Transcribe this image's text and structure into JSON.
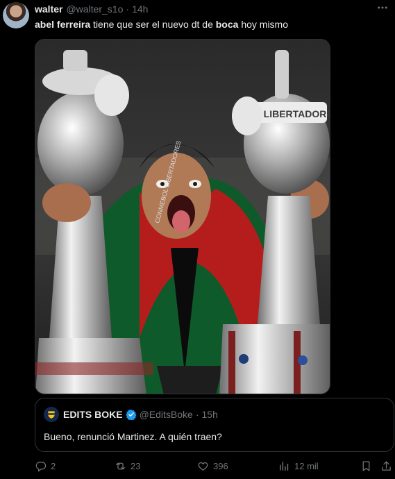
{
  "author": {
    "name": "walter",
    "handle": "@walter_s1o",
    "separator": "·",
    "time": "14h",
    "avatar_icon": "user-avatar"
  },
  "tweet": {
    "text_parts": [
      "abel ferreira",
      " tiene que ser el nuevo dt de ",
      "boca",
      " hoy mismo"
    ]
  },
  "media": {
    "image_text": [
      "COPA LIBERTADORES",
      "CONMEBOL LIBERTADORES"
    ]
  },
  "quoted": {
    "name": "EDITS BOKE",
    "handle": "@EditsBoke",
    "separator": "·",
    "time": "15h",
    "text": "Bueno, renunció Martinez. A quién traen?",
    "verified_color": "#1d9bf0"
  },
  "actions": {
    "replies": "2",
    "reposts": "23",
    "likes": "396",
    "views": "12 mil"
  },
  "colors": {
    "background": "#000000",
    "text_primary": "#e7e9ea",
    "text_secondary": "#71767b",
    "border": "#2f3336"
  },
  "icons": [
    "more-icon",
    "verified-badge-icon",
    "reply-icon",
    "repost-icon",
    "like-icon",
    "views-icon",
    "bookmark-icon",
    "share-icon"
  ]
}
